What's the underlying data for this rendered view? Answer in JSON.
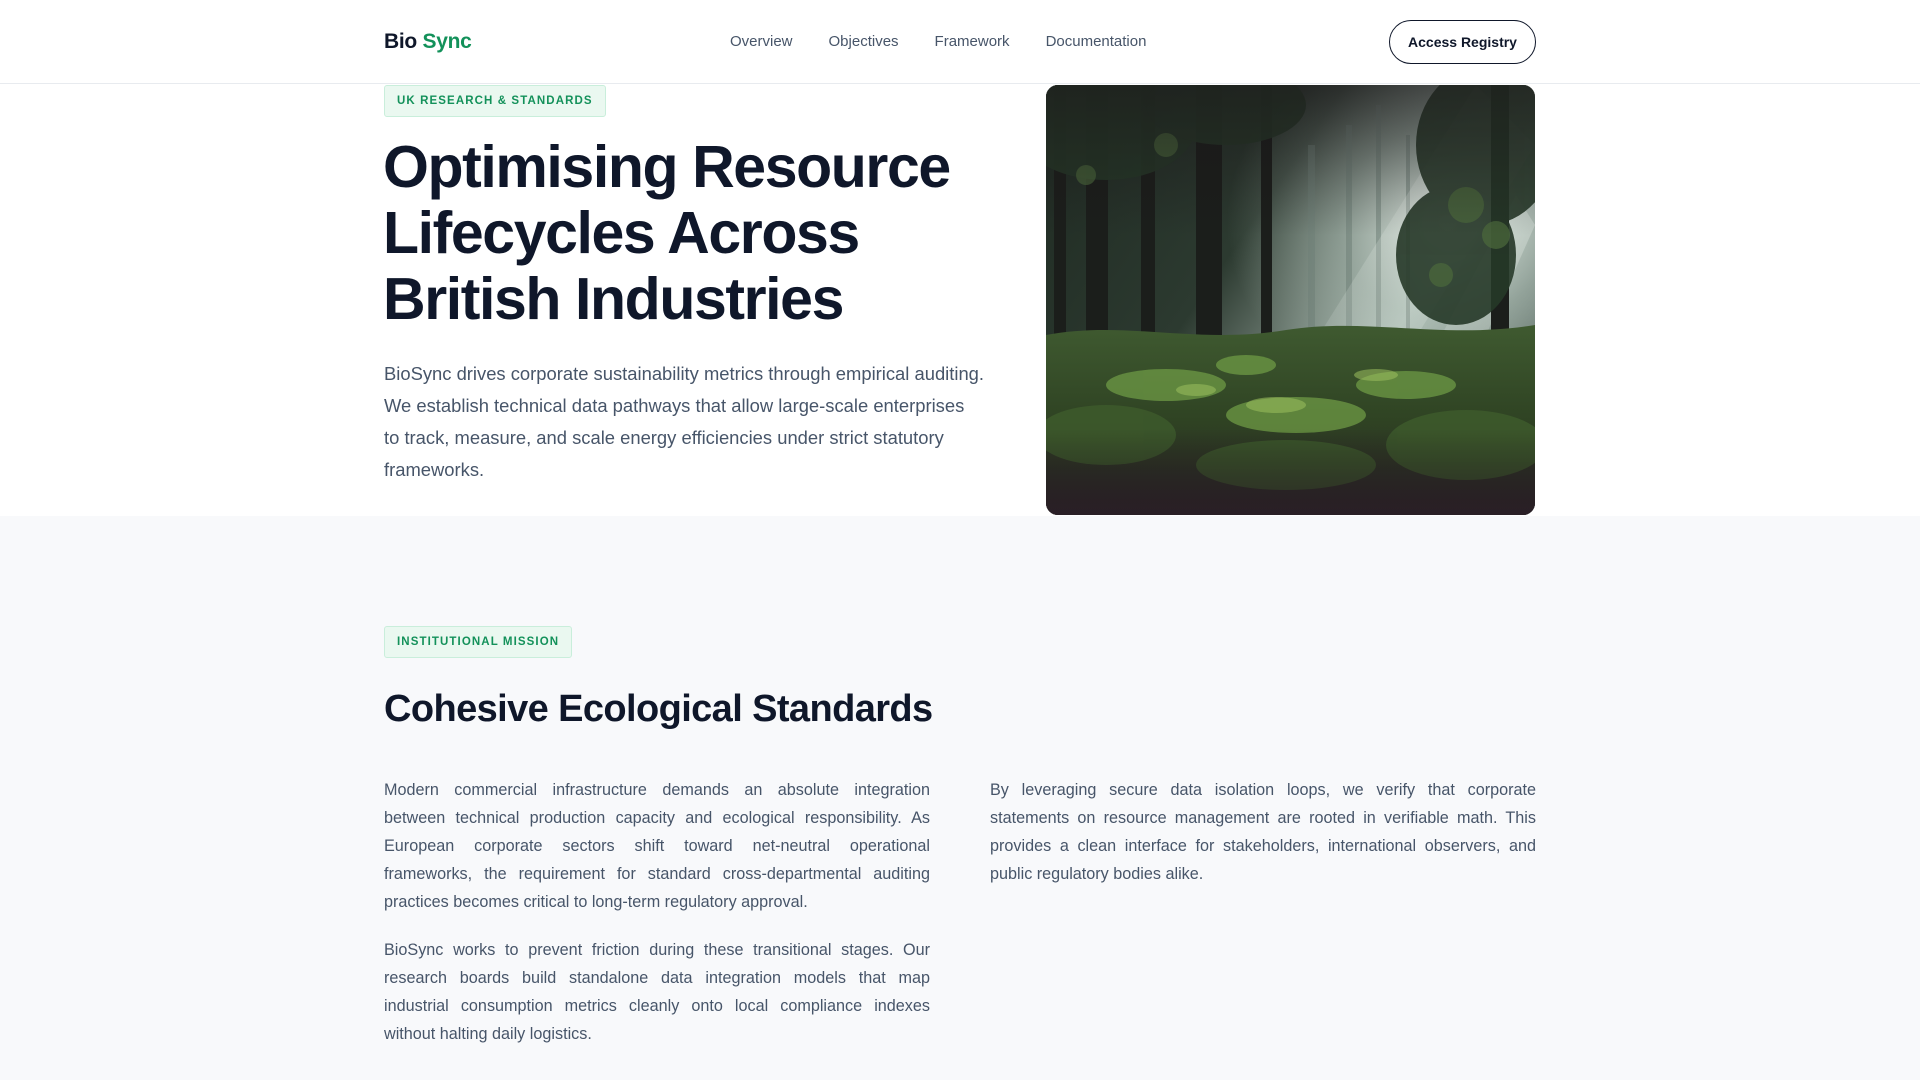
{
  "header": {
    "brand_primary": "Bio",
    "brand_accent": "Sync",
    "nav": [
      "Overview",
      "Objectives",
      "Framework",
      "Documentation"
    ],
    "cta_label": "Access Registry"
  },
  "hero": {
    "tag": "UK RESEARCH & STANDARDS",
    "title": "Optimising Resource Lifecycles Across British Industries",
    "description": "BioSync drives corporate sustainability metrics through empirical auditing. We establish technical data pathways that allow large-scale enterprises to track, measure, and scale energy efficiencies under strict statutory frameworks.",
    "image_icon": "forest-photo"
  },
  "mission": {
    "tag": "INSTITUTIONAL MISSION",
    "title": "Cohesive Ecological Standards",
    "paragraphs_left": [
      "Modern commercial infrastructure demands an absolute integration between technical production capacity and ecological responsibility. As European corporate sectors shift toward net-neutral operational frameworks, the requirement for standard cross-departmental auditing practices becomes critical to long-term regulatory approval.",
      "BioSync works to prevent friction during these transitional stages. Our research boards build standalone data integration models that map industrial consumption metrics cleanly onto local compliance indexes without halting daily logistics."
    ],
    "paragraphs_right": [
      "By leveraging secure data isolation loops, we verify that corporate statements on resource management are rooted in verifiable math. This provides a clean interface for stakeholders, international observers, and public regulatory bodies alike."
    ]
  },
  "colors": {
    "accent": "#13915a",
    "text_dark": "#0f172a",
    "text_body": "#475569",
    "tag_background": "#eaf8f0",
    "section_background": "#f8f9fb"
  }
}
